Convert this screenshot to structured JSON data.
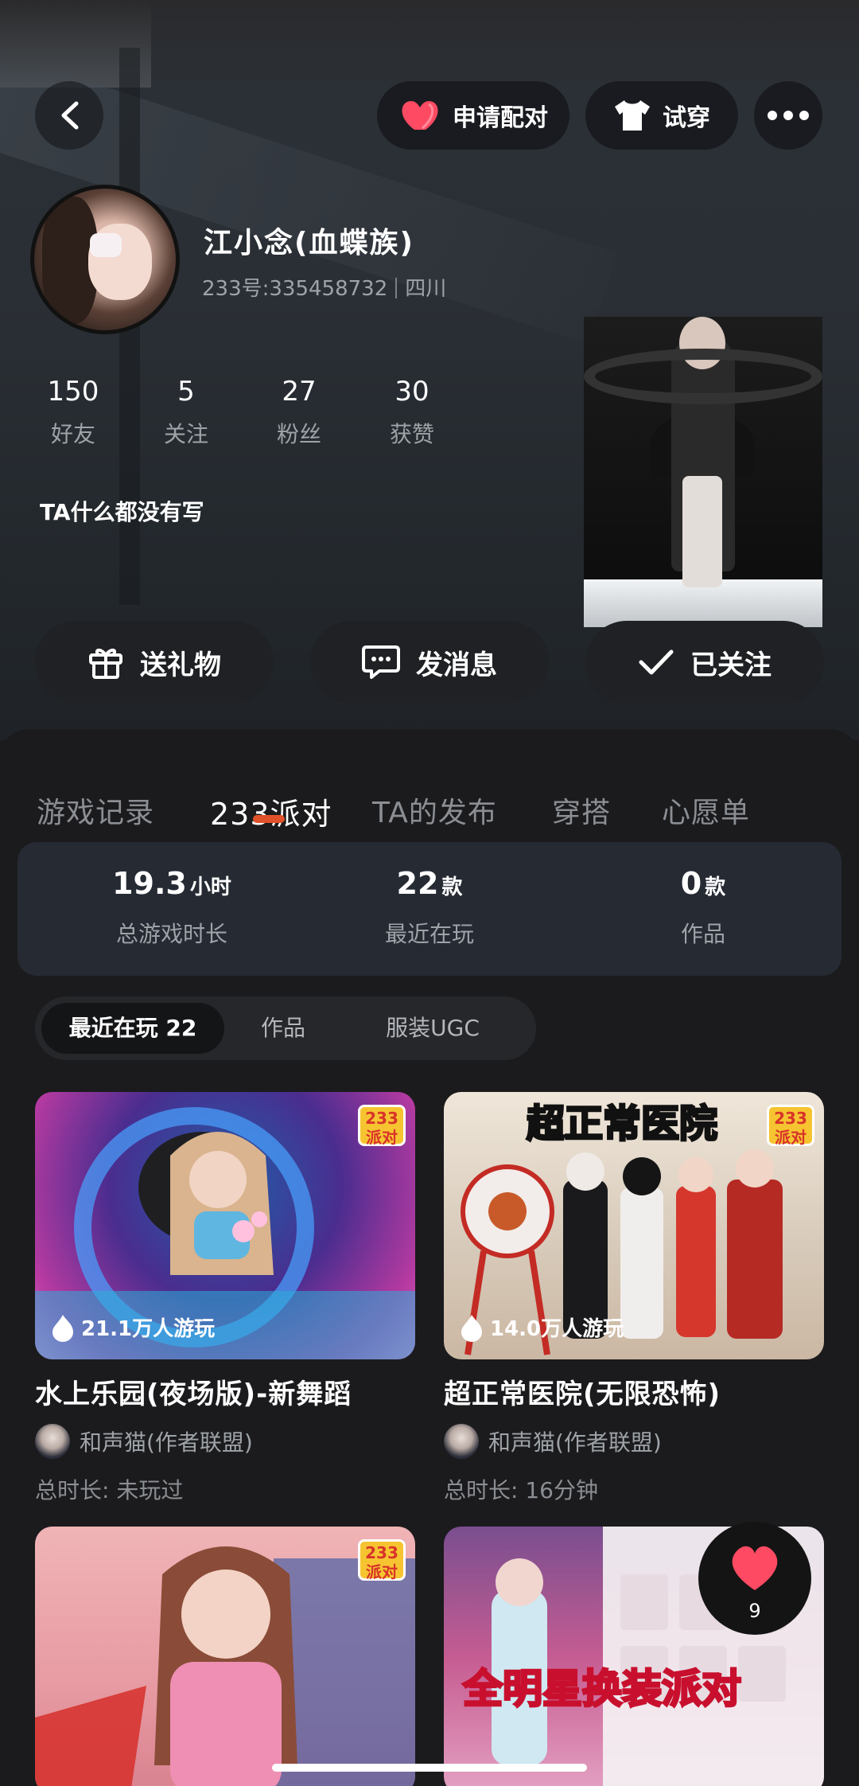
{
  "header": {
    "apply_pair_label": "申请配对",
    "try_on_label": "试穿"
  },
  "profile": {
    "name": "江小念(血蝶族)",
    "uid": "233号:335458732",
    "region": "四川",
    "bio": "TA什么都没有写",
    "stats": [
      {
        "value": "150",
        "label": "好友"
      },
      {
        "value": "5",
        "label": "关注"
      },
      {
        "value": "27",
        "label": "粉丝"
      },
      {
        "value": "30",
        "label": "获赞"
      }
    ]
  },
  "actions": {
    "gift": "送礼物",
    "message": "发消息",
    "follow": "已关注"
  },
  "tabs": [
    "游戏记录",
    "233派对",
    "TA的发布",
    "穿搭",
    "心愿单"
  ],
  "active_tab": "233派对",
  "summary": [
    {
      "value": "19.3",
      "unit": "小时",
      "label": "总游戏时长"
    },
    {
      "value": "22",
      "unit": "款",
      "label": "最近在玩"
    },
    {
      "value": "0",
      "unit": "款",
      "label": "作品"
    }
  ],
  "filters": [
    "最近在玩 22",
    "作品",
    "服装UGC"
  ],
  "games": [
    {
      "title": "水上乐园(夜场版)-新舞蹈",
      "players": "21.1万人游玩",
      "author": "和声猫(作者联盟)",
      "time": "总时长: 未玩过",
      "badge_top": "233",
      "badge_bottom": "派对"
    },
    {
      "title": "超正常医院(无限恐怖)",
      "players": "14.0万人游玩",
      "author": "和声猫(作者联盟)",
      "time": "总时长: 16分钟",
      "badge_top": "233",
      "badge_bottom": "派对",
      "banner": "超正常医院"
    },
    {
      "badge_top": "233",
      "badge_bottom": "派对"
    },
    {
      "banner": "全明星换装派对"
    }
  ],
  "floating_heart": {
    "count": "9"
  },
  "colors": {
    "accent": "#e0522a",
    "heart": "#ff4a63",
    "badge": "#f6c431"
  }
}
